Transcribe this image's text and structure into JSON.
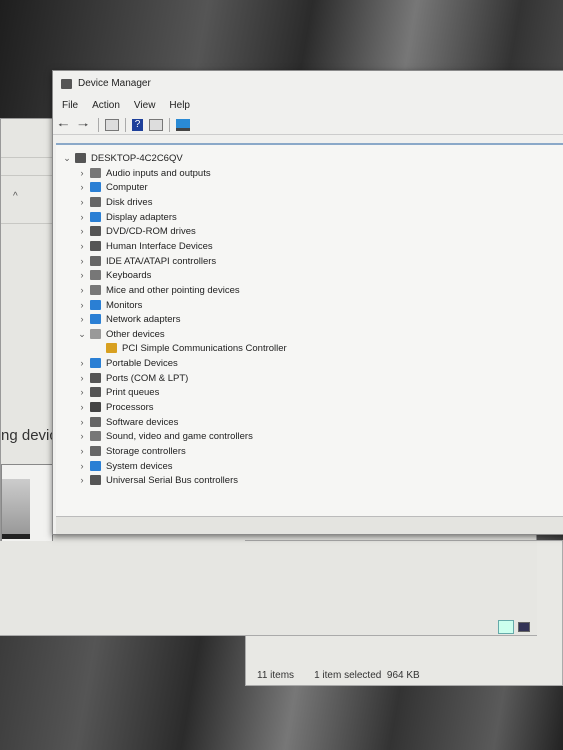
{
  "back_window": {
    "partial_text": "ng devic",
    "chevron": "^"
  },
  "explorer_status": {
    "items": "11 items",
    "selected": "1 item selected",
    "size": "964 KB"
  },
  "window": {
    "title": "Device Manager"
  },
  "menu": [
    "File",
    "Action",
    "View",
    "Help"
  ],
  "toolbar": [
    "back-icon",
    "forward-icon",
    "properties-icon",
    "help-icon",
    "update-driver-icon",
    "monitor-icon"
  ],
  "tree": {
    "root": "DESKTOP-4C2C6QV",
    "items": [
      {
        "label": "Audio inputs and outputs",
        "icon": "speaker-icon",
        "color": "#777"
      },
      {
        "label": "Computer",
        "icon": "computer-icon",
        "color": "#2a7fd4"
      },
      {
        "label": "Disk drives",
        "icon": "disk-icon",
        "color": "#666"
      },
      {
        "label": "Display adapters",
        "icon": "display-icon",
        "color": "#2a7fd4"
      },
      {
        "label": "DVD/CD-ROM drives",
        "icon": "dvd-icon",
        "color": "#555"
      },
      {
        "label": "Human Interface Devices",
        "icon": "hid-icon",
        "color": "#555"
      },
      {
        "label": "IDE ATA/ATAPI controllers",
        "icon": "ide-icon",
        "color": "#666"
      },
      {
        "label": "Keyboards",
        "icon": "keyboard-icon",
        "color": "#777"
      },
      {
        "label": "Mice and other pointing devices",
        "icon": "mouse-icon",
        "color": "#777"
      },
      {
        "label": "Monitors",
        "icon": "monitor-icon",
        "color": "#2a7fd4"
      },
      {
        "label": "Network adapters",
        "icon": "network-icon",
        "color": "#2a7fd4"
      },
      {
        "label": "Other devices",
        "icon": "other-devices-icon",
        "color": "#999",
        "expanded": true,
        "children": [
          {
            "label": "PCI Simple Communications Controller",
            "icon": "warning-device-icon",
            "color": "#d8a020"
          }
        ]
      },
      {
        "label": "Portable Devices",
        "icon": "portable-icon",
        "color": "#2a7fd4"
      },
      {
        "label": "Ports (COM & LPT)",
        "icon": "port-icon",
        "color": "#555"
      },
      {
        "label": "Print queues",
        "icon": "printer-icon",
        "color": "#555"
      },
      {
        "label": "Processors",
        "icon": "processor-icon",
        "color": "#444"
      },
      {
        "label": "Software devices",
        "icon": "software-icon",
        "color": "#666"
      },
      {
        "label": "Sound, video and game controllers",
        "icon": "sound-icon",
        "color": "#777"
      },
      {
        "label": "Storage controllers",
        "icon": "storage-icon",
        "color": "#666"
      },
      {
        "label": "System devices",
        "icon": "system-icon",
        "color": "#2a7fd4"
      },
      {
        "label": "Universal Serial Bus controllers",
        "icon": "usb-icon",
        "color": "#555"
      }
    ]
  }
}
